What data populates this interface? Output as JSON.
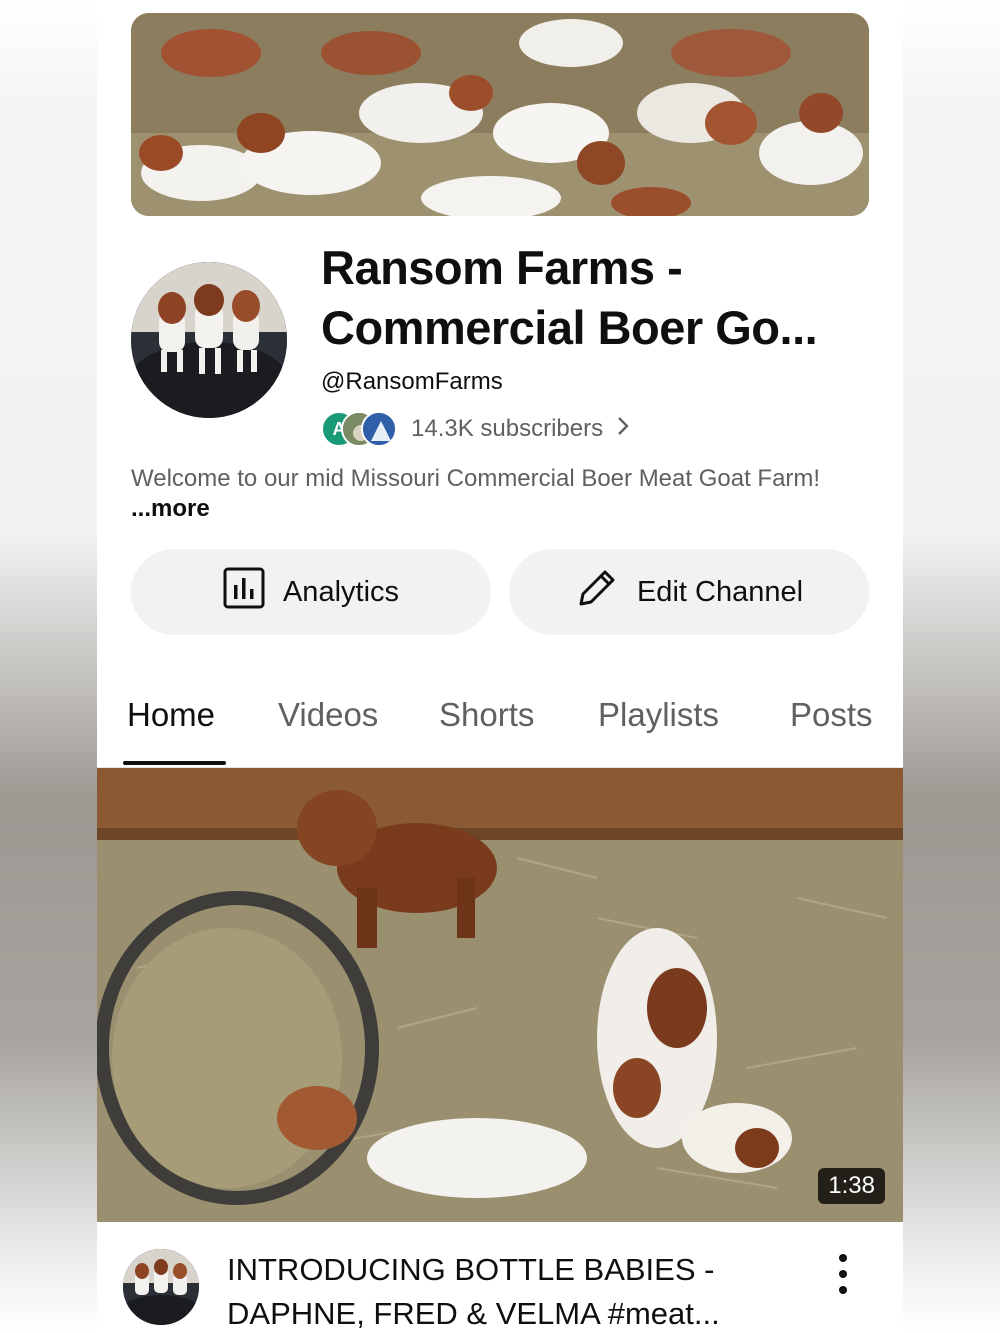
{
  "channel": {
    "title_line1": "Ransom Farms -",
    "title_line2": "Commercial Boer Go...",
    "handle": "@RansomFarms",
    "subscriber_avatar_initial": "A",
    "subscribers": "14.3K subscribers",
    "description": "Welcome to our mid Missouri Commercial Boer Meat Goat Farm!",
    "more_label": "...more"
  },
  "actions": {
    "analytics_label": "Analytics",
    "edit_label": "Edit Channel"
  },
  "tabs": [
    {
      "label": "Home",
      "active": true
    },
    {
      "label": "Videos",
      "active": false
    },
    {
      "label": "Shorts",
      "active": false
    },
    {
      "label": "Playlists",
      "active": false
    },
    {
      "label": "Posts",
      "active": false
    }
  ],
  "featured_video": {
    "duration": "1:38",
    "title_line1": "INTRODUCING BOTTLE BABIES -",
    "title_line2": "DAPHNE, FRED & VELMA #meat..."
  },
  "colors": {
    "text_primary": "#0f0f0f",
    "text_secondary": "#606060",
    "button_bg": "#f2f2f2",
    "subscriber_avatar_a": "#1b9a78"
  },
  "icons": {
    "analytics": "bar-chart-icon",
    "edit": "pencil-icon",
    "subs_chevron": "chevron-right-icon",
    "video_menu": "more-vert-icon"
  }
}
